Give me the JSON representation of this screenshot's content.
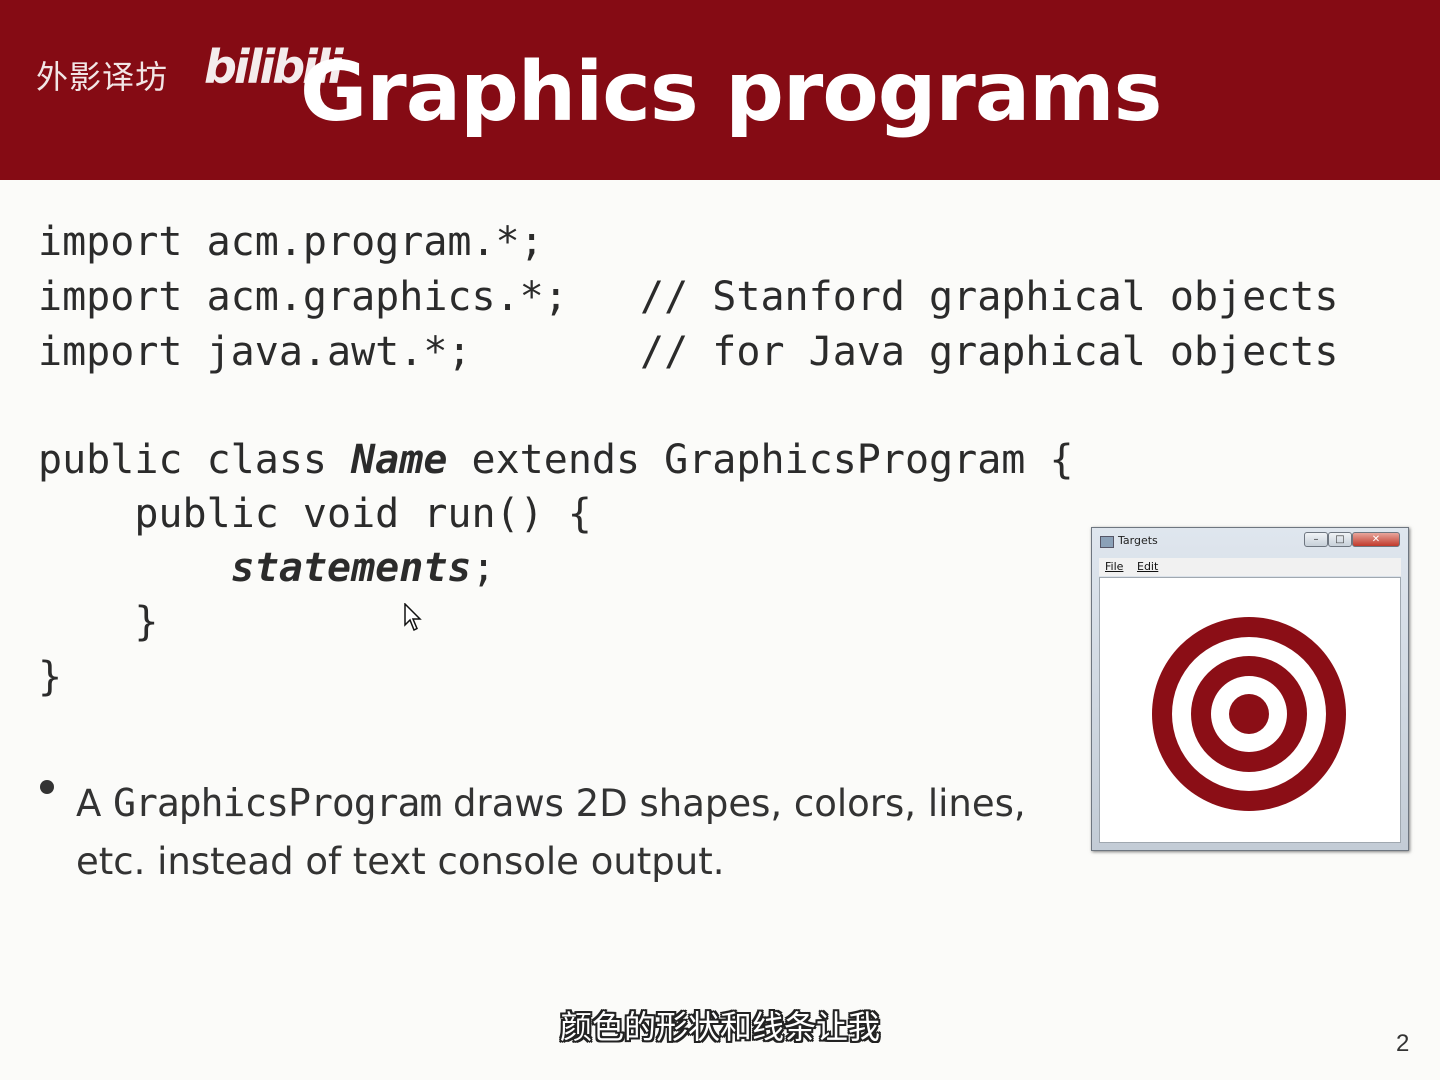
{
  "watermark": {
    "text": "外影译坊",
    "logo": "bilibili"
  },
  "slide": {
    "title": "Graphics programs",
    "page_number": "2"
  },
  "code": {
    "lines": [
      {
        "plain": "import acm.program.*;"
      },
      {
        "plain": "import acm.graphics.*;   // Stanford graphical objects"
      },
      {
        "plain": "import java.awt.*;       // for Java graphical objects"
      },
      {
        "pre": "public class ",
        "italic": "Name",
        "post": " extends GraphicsProgram {"
      },
      {
        "plain": "    public void run() {"
      },
      {
        "pre": "        ",
        "italic": "statements",
        "post": ";"
      },
      {
        "plain": "    }"
      },
      {
        "plain": "}"
      }
    ]
  },
  "bullet": {
    "pre": "A ",
    "mono": "GraphicsProgram",
    "post": " draws 2D shapes, colors, lines, etc. instead of text console output."
  },
  "window": {
    "title": "Targets",
    "menu": [
      "File",
      "Edit"
    ],
    "buttons": {
      "minimize": "–",
      "maximize": "□",
      "close": "✕"
    },
    "target_color": "#8b0e16",
    "ring_colors": [
      "#8b0e16",
      "#ffffff",
      "#8b0e16",
      "#ffffff",
      "#8b0e16"
    ]
  },
  "subtitle": "颜色的形状和线条让我",
  "colors": {
    "header": "#850b14",
    "background": "#fbfbf9"
  }
}
